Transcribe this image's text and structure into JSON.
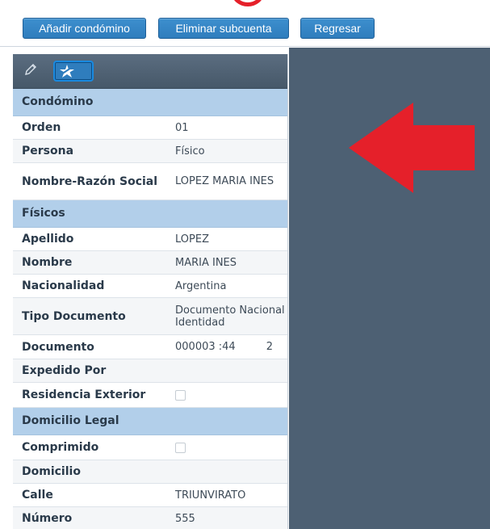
{
  "toolbar": {
    "add_label": "Añadir condómino",
    "delete_label": "Eliminar subcuenta",
    "back_label": "Regresar"
  },
  "grid_header": {
    "edit_icon": "pencil-icon",
    "action_icon": "star-icon"
  },
  "sections": {
    "condomino": "Condómino",
    "fisicos": "Físicos",
    "domicilio_legal": "Domicilio Legal",
    "domicilio": "Domicilio"
  },
  "fields": {
    "orden": {
      "label": "Orden",
      "value": "01"
    },
    "persona": {
      "label": "Persona",
      "value": "Físico"
    },
    "razon_social": {
      "label": "Nombre-Razón Social",
      "value": "LOPEZ MARIA INES"
    },
    "apellido": {
      "label": "Apellido",
      "value": "LOPEZ"
    },
    "nombre": {
      "label": "Nombre",
      "value": "MARIA INES"
    },
    "nacionalidad": {
      "label": "Nacionalidad",
      "value": "Argentina"
    },
    "tipo_documento": {
      "label": "Tipo Documento",
      "value": "Documento Nacional Identidad"
    },
    "documento": {
      "label": "Documento",
      "value_start": "000003 :44",
      "value_end": "2"
    },
    "expedido_por": {
      "label": "Expedido Por",
      "value": ""
    },
    "residencia_exterior": {
      "label": "Residencia Exterior",
      "checked": false
    },
    "comprimido": {
      "label": "Comprimido",
      "checked": false
    },
    "calle": {
      "label": "Calle",
      "value": "TRIUNVIRATO"
    },
    "numero": {
      "label": "Número",
      "value": "555"
    }
  },
  "colors": {
    "button_blue": "#2f7dbd",
    "section_blue": "#b2cfea",
    "panel_slate": "#4d6073",
    "annotation_red": "#e5202a"
  }
}
